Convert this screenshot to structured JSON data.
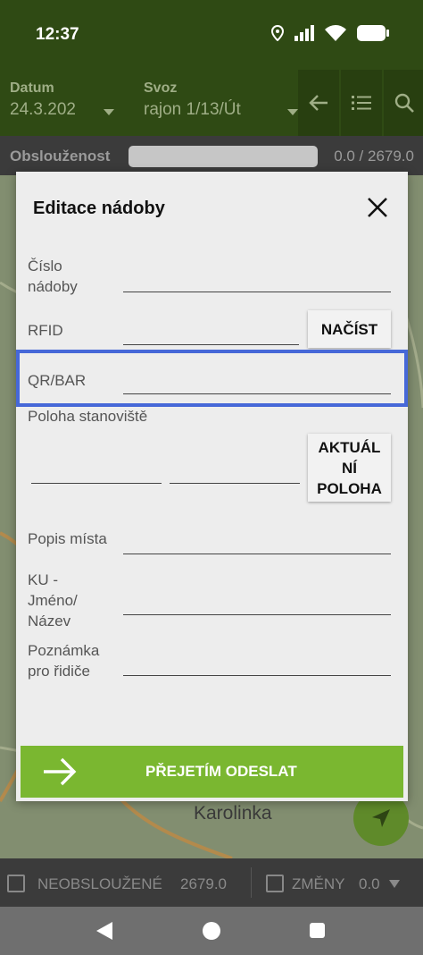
{
  "status_bar": {
    "time": "12:37"
  },
  "header": {
    "date_label": "Datum",
    "date_value": "24.3.202",
    "route_label": "Svoz",
    "route_value": "rajon 1/13/Út"
  },
  "progress": {
    "label": "Obslouženost",
    "value": "0.0 / 2679.0",
    "fraction": 0.0
  },
  "map": {
    "place_label": "Karolinka"
  },
  "dialog": {
    "title": "Editace nádoby",
    "container_number_label": "Číslo nádoby",
    "rfid_label": "RFID",
    "load_button": "NAČÍST",
    "qr_label": "QR/BAR",
    "location_label": "Poloha stanoviště",
    "current_location_button": "AKTUÁL NÍ POLOHA",
    "place_description_label": "Popis místa",
    "ku_label": "KU - Jméno/ Název",
    "driver_note_label": "Poznámka pro řidiče",
    "submit_button": "PŘEJETÍM ODESLAT"
  },
  "filter_bar": {
    "unserved_label": "NEOBSLOUŽENÉ",
    "unserved_value": "2679.0",
    "changes_label": "ZMĚNY",
    "changes_value": "0.0"
  },
  "colors": {
    "header_bg": "#2f4a14",
    "accent_green": "#7ab730",
    "highlight_blue": "#4668d8",
    "dialog_bg": "#ededed"
  }
}
